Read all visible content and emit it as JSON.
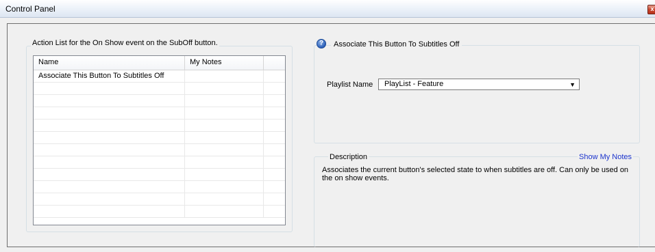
{
  "window": {
    "title": "Control Panel",
    "close_icon": "close-icon",
    "close_glyph": "x"
  },
  "action_list": {
    "legend": "Action List for the On Show event on the SubOff button.",
    "columns": [
      "Name",
      "My Notes",
      ""
    ],
    "rows": [
      {
        "name": "Associate This Button To Subtitles Off",
        "notes": ""
      },
      {
        "name": "",
        "notes": ""
      },
      {
        "name": "",
        "notes": ""
      },
      {
        "name": "",
        "notes": ""
      },
      {
        "name": "",
        "notes": ""
      },
      {
        "name": "",
        "notes": ""
      },
      {
        "name": "",
        "notes": ""
      },
      {
        "name": "",
        "notes": ""
      },
      {
        "name": "",
        "notes": ""
      },
      {
        "name": "",
        "notes": ""
      },
      {
        "name": "",
        "notes": ""
      },
      {
        "name": "",
        "notes": ""
      }
    ]
  },
  "properties": {
    "legend": "Associate This Button To Subtitles Off",
    "help_icon": "help-icon",
    "help_glyph": "?",
    "playlist_label": "Playlist Name",
    "playlist_value": "PlayList - Feature",
    "dropdown_glyph": "▼"
  },
  "description": {
    "legend": "Description",
    "show_notes_link": "Show My Notes",
    "text": "Associates the current button's selected state to when subtitles are off. Can only be used on the on show events."
  },
  "colors": {
    "link": "#1a33cc",
    "window_bg": "#f0f0f0",
    "close_button": "#c9462f"
  }
}
